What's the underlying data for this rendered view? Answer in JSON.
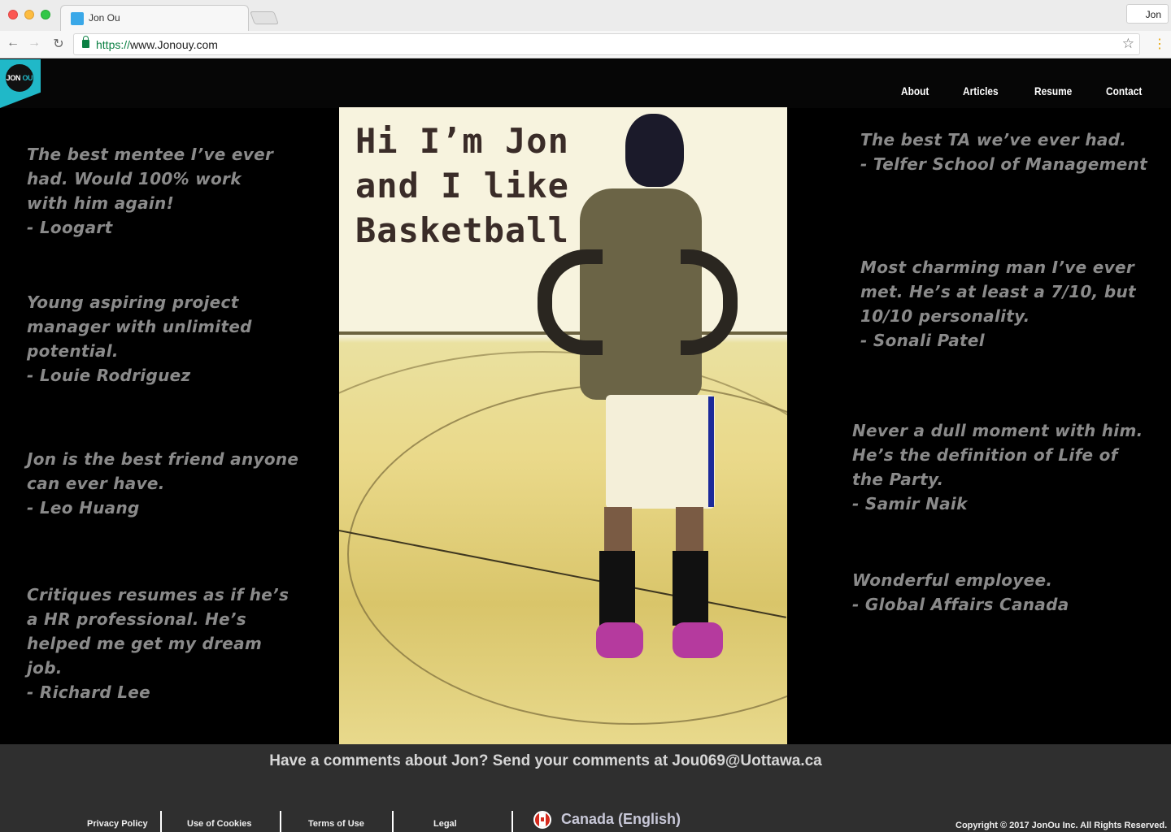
{
  "browser": {
    "tab_title": "Jon Ou",
    "profile": "Jon",
    "url_scheme": "https://",
    "url_rest": "www.Jonouy.com",
    "icons": [
      "back-arrow-icon",
      "forward-arrow-icon",
      "reload-icon",
      "lock-icon",
      "star-icon",
      "menu-icon"
    ]
  },
  "logo": {
    "part1": "JON",
    "part2": "OU"
  },
  "nav": {
    "about": "About",
    "articles": "Articles",
    "resume": "Resume",
    "contact": "Contact"
  },
  "hero": {
    "line1": "Hi I’m Jon",
    "line2": "and I like",
    "line3": "Basketball"
  },
  "testimonials_left": [
    {
      "quote": "The best  mentee I’ve ever had. Would 100% work with him again!",
      "author": "- Loogart"
    },
    {
      "quote": "Young aspiring project manager with unlimited potential.",
      "author": "- Louie Rodriguez"
    },
    {
      "quote": "Jon is the best friend anyone can ever have.",
      "author": "- Leo Huang"
    },
    {
      "quote": "Critiques resumes as if he’s a HR professional. He’s helped me get my dream job.",
      "author": "- Richard Lee"
    }
  ],
  "testimonials_right": [
    {
      "quote": "The best TA we’ve ever had.",
      "author": "- Telfer School of Management"
    },
    {
      "quote": "Most charming man I’ve ever met. He’s at least a 7/10, but 10/10 personality.",
      "author": "- Sonali Patel"
    },
    {
      "quote": "Never a dull moment with him. He’s the definition of Life of the Party.",
      "author": "- Samir Naik"
    },
    {
      "quote": "Wonderful employee.",
      "author": "- Global Affairs Canada"
    }
  ],
  "footer": {
    "cta": "Have a comments about Jon?  Send your comments at Jou069@Uottawa.ca",
    "links": {
      "privacy": "Privacy Policy",
      "cookies": "Use of Cookies",
      "terms": "Terms of Use",
      "legal": "Legal"
    },
    "locale": "Canada (English)",
    "copyright": "Copyright © 2017 JonOu Inc. All Rights  Reserved."
  },
  "colors": {
    "accent": "#20b8c8",
    "testimonial": "#8a8a8a",
    "footer_bg": "#2f2f2f"
  }
}
